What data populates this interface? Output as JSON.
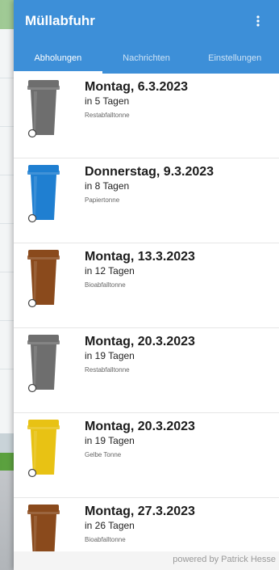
{
  "app": {
    "title": "Müllabfuhr",
    "menu_icon": "more-vert-icon",
    "accent": "#3d8fd8"
  },
  "tabs": [
    {
      "label": "Abholungen",
      "active": true
    },
    {
      "label": "Nachrichten",
      "active": false
    },
    {
      "label": "Einstellungen",
      "active": false
    }
  ],
  "pickups": [
    {
      "date": "Montag, 6.3.2023",
      "in_days": "in 5 Tagen",
      "bin_type": "Restabfalltonne",
      "bin_color": "#6e6e6e",
      "bin_icon": "trash-bin-icon"
    },
    {
      "date": "Donnerstag, 9.3.2023",
      "in_days": "in 8 Tagen",
      "bin_type": "Papiertonne",
      "bin_color": "#1f7fd1",
      "bin_icon": "trash-bin-icon"
    },
    {
      "date": "Montag, 13.3.2023",
      "in_days": "in 12 Tagen",
      "bin_type": "Bioabfalltonne",
      "bin_color": "#8a4a1c",
      "bin_icon": "trash-bin-icon"
    },
    {
      "date": "Montag, 20.3.2023",
      "in_days": "in 19 Tagen",
      "bin_type": "Restabfalltonne",
      "bin_color": "#6e6e6e",
      "bin_icon": "trash-bin-icon"
    },
    {
      "date": "Montag, 20.3.2023",
      "in_days": "in 19 Tagen",
      "bin_type": "Gelbe Tonne",
      "bin_color": "#e8c214",
      "bin_icon": "trash-bin-icon"
    },
    {
      "date": "Montag, 27.3.2023",
      "in_days": "in 26 Tagen",
      "bin_type": "Bioabfalltonne",
      "bin_color": "#8a4a1c",
      "bin_icon": "trash-bin-icon"
    }
  ],
  "footer": {
    "text": "powered by Patrick Hesse"
  }
}
